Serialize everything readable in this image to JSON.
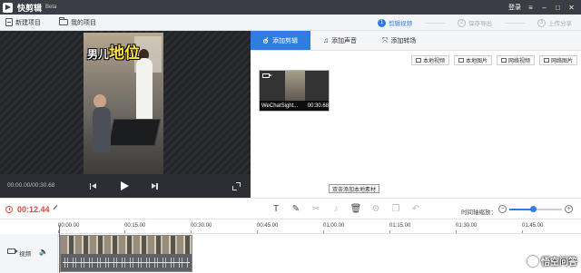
{
  "app": {
    "title": "快剪辑",
    "edition": "Beta",
    "login": "登录"
  },
  "toolbar": {
    "new_project": "新建项目",
    "my_projects": "我的项目"
  },
  "steps": [
    {
      "num": "1",
      "label": "剪辑视频"
    },
    {
      "num": "2",
      "label": "保存导出"
    },
    {
      "num": "3",
      "label": "上传分享"
    }
  ],
  "preview": {
    "caption_small": "男儿",
    "caption_big": "地位",
    "time": "00:00.00/00:30.68"
  },
  "tabs": [
    "添加剪辑",
    "添加声音",
    "添加转场"
  ],
  "source_buttons": [
    "本地视频",
    "本地图片",
    "网络视频",
    "网络图片"
  ],
  "media": {
    "name": "WeChatSight...",
    "duration": "00:30.68"
  },
  "tooltip": "双击添加本地素材",
  "editbar": {
    "current_time": "00:12.44",
    "zoom_label": "时间轴缩放：",
    "zoom_level": 0.45
  },
  "ruler_ticks": [
    "00:00.00",
    "00:15.00",
    "00:30.00",
    "00:45.00",
    "01:00.00",
    "01:15.00",
    "01:30.00",
    "01:45.00"
  ],
  "track": {
    "label": "视频"
  },
  "watermark": "悟空问答",
  "colors": {
    "accent": "#2f7de1",
    "time_red": "#d94a3c",
    "titlebar": "#3a3d44"
  }
}
